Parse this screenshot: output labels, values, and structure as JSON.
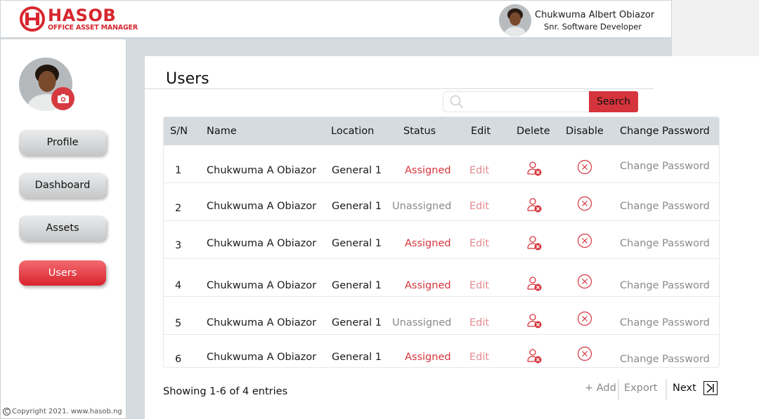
{
  "brand": {
    "title": "HASOB",
    "subtitle": "OFFICE ASSET MANAGER",
    "color": "#d7262e"
  },
  "user": {
    "name": "Chukwuma Albert Obiazor",
    "role": "Snr. Software Developer"
  },
  "sidebar": {
    "items": [
      {
        "label": "Profile",
        "active": false
      },
      {
        "label": "Dashboard",
        "active": false
      },
      {
        "label": "Assets",
        "active": false
      },
      {
        "label": "Users",
        "active": true
      }
    ],
    "copyright": "Copyright 2021. www.hasob.ng"
  },
  "page": {
    "title": "Users"
  },
  "search": {
    "placeholder": "",
    "value": "",
    "button_label": "Search"
  },
  "table": {
    "headers": [
      "S/N",
      "Name",
      "Location",
      "Status",
      "Edit",
      "Delete",
      "Disable",
      "Change Password"
    ],
    "rows": [
      {
        "sn": "1",
        "name": "Chukwuma A Obiazor",
        "location": "General 1",
        "status": "Assigned",
        "edit": "Edit",
        "change_password": "Change Password"
      },
      {
        "sn": "2",
        "name": "Chukwuma A Obiazor",
        "location": "General 1",
        "status": "Unassigned",
        "edit": "Edit",
        "change_password": "Change Password"
      },
      {
        "sn": "3",
        "name": "Chukwuma A Obiazor",
        "location": "General 1",
        "status": "Assigned",
        "edit": "Edit",
        "change_password": "Change Password"
      },
      {
        "sn": "4",
        "name": "Chukwuma A Obiazor",
        "location": "General 1",
        "status": "Assigned",
        "edit": "Edit",
        "change_password": "Change Password"
      },
      {
        "sn": "5",
        "name": "Chukwuma A Obiazor",
        "location": "General 1",
        "status": "Unassigned",
        "edit": "Edit",
        "change_password": "Change Password"
      },
      {
        "sn": "6",
        "name": "Chukwuma A Obiazor",
        "location": "General 1",
        "status": "Assigned",
        "edit": "Edit",
        "change_password": "Change Password"
      }
    ],
    "delete_icon": "user-remove-icon",
    "disable_icon": "circle-x-icon"
  },
  "footer": {
    "info": "Showing 1-6 of 4 entries",
    "add_label": "+ Add",
    "export_label": "Export",
    "next_label": "Next"
  },
  "colors": {
    "accent": "#d6343c",
    "muted": "#8a8a8a",
    "header_bg": "#d5dbdf"
  }
}
